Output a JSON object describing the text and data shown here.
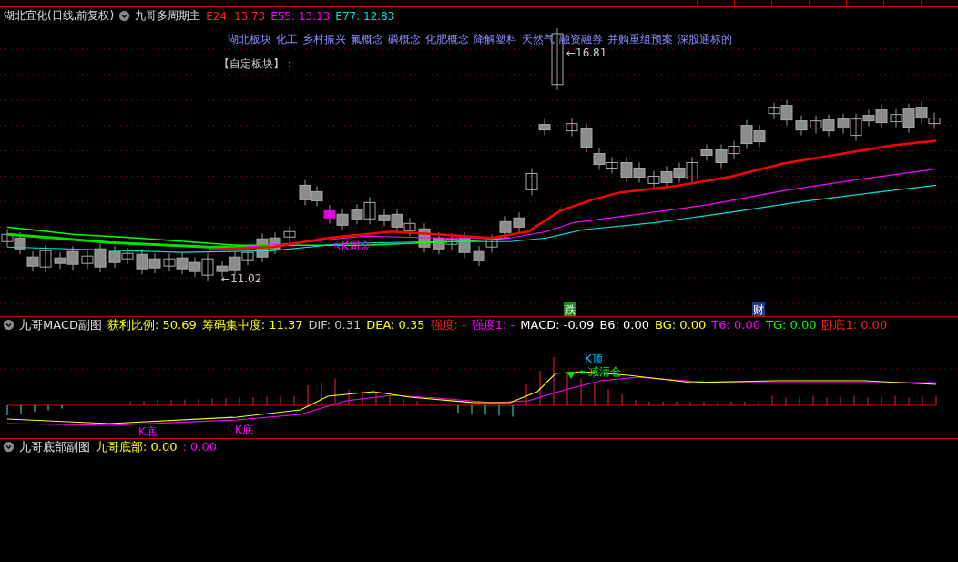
{
  "header": {
    "stock": "湖北宜化(日线,前复权)",
    "indicator": "九哥多周期主",
    "values": [
      {
        "text": "E24: 13.73",
        "color": "#ff2020"
      },
      {
        "text": "E55: 13.13",
        "color": "#ff00ff"
      },
      {
        "text": "E77: 12.83",
        "color": "#00e0e0"
      }
    ]
  },
  "concepts": [
    "湖北板块",
    "化工",
    "乡村振兴",
    "氟概念",
    "磷概念",
    "化肥概念",
    "降解塑料",
    "天然气",
    "融资融券",
    "并购重组预案",
    "深股通标的"
  ],
  "custom_block": "【自定板块】：",
  "main_chart": {
    "annotations": [
      "←16.81",
      "←11.02",
      "↖K周金"
    ],
    "markers": [
      {
        "text": "跌",
        "color": "#1e8c1e"
      },
      {
        "text": "财",
        "color": "#1e3c8c"
      }
    ]
  },
  "macd_pane": {
    "title": "九哥MACD副图",
    "values": [
      {
        "text": "获利比例: 50.69",
        "color": "#ffff00"
      },
      {
        "text": "筹码集中度: 11.37",
        "color": "#ffff00"
      },
      {
        "text": "DIF: 0.31",
        "color": "#c8c8c8"
      },
      {
        "text": "DEA: 0.35",
        "color": "#ffff00"
      },
      {
        "text": "强度: -",
        "color": "#ff2020"
      },
      {
        "text": "强度1: -",
        "color": "#ff00ff"
      },
      {
        "text": "MACD: -0.09",
        "color": "#ffffff"
      },
      {
        "text": "B6: 0.00",
        "color": "#ffffff"
      },
      {
        "text": "BG: 0.00",
        "color": "#ffff00"
      },
      {
        "text": "T6: 0.00",
        "color": "#ff00ff"
      },
      {
        "text": "TG: 0.00",
        "color": "#00ff00"
      },
      {
        "text": "卧底1: 0.00",
        "color": "#ff2020"
      }
    ],
    "annotations": [
      "K底",
      "K底",
      "K顶",
      "←减清仓"
    ]
  },
  "bottom_pane": {
    "title": "九哥底部副图",
    "values": [
      {
        "text": "九哥底部: 0.00",
        "color": "#ffff00"
      },
      {
        "text": ": 0.00",
        "color": "#ff00ff"
      }
    ]
  }
}
